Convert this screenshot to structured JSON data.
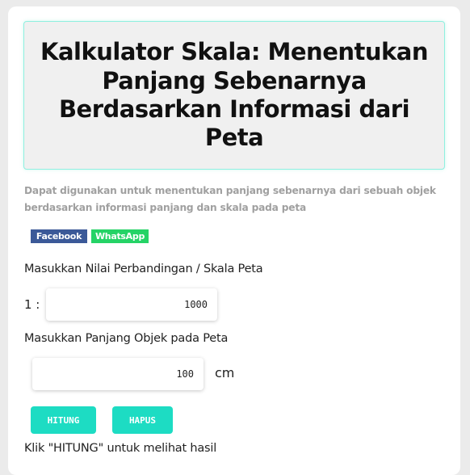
{
  "title": "Kalkulator Skala: Menentukan Panjang Sebenarnya Berdasarkan Informasi dari Peta",
  "description": "Dapat digunakan untuk menentukan panjang sebenarnya dari sebuah objek berdasarkan informasi panjang dan skala pada peta",
  "share": {
    "facebook_label": "Facebook",
    "whatsapp_label": "WhatsApp"
  },
  "scale": {
    "label": "Masukkan Nilai Perbandingan / Skala Peta",
    "prefix": "1 :",
    "value": "1000"
  },
  "length": {
    "label": "Masukkan Panjang Objek pada Peta",
    "value": "100",
    "unit": "cm"
  },
  "buttons": {
    "calculate_label": "HITUNG",
    "clear_label": "HAPUS"
  },
  "result_text": "Klik \"HITUNG\" untuk melihat hasil",
  "colors": {
    "accent": "#1ddcc3",
    "facebook": "#3b5998",
    "whatsapp": "#25d366",
    "title_border": "#8ef0e0"
  }
}
